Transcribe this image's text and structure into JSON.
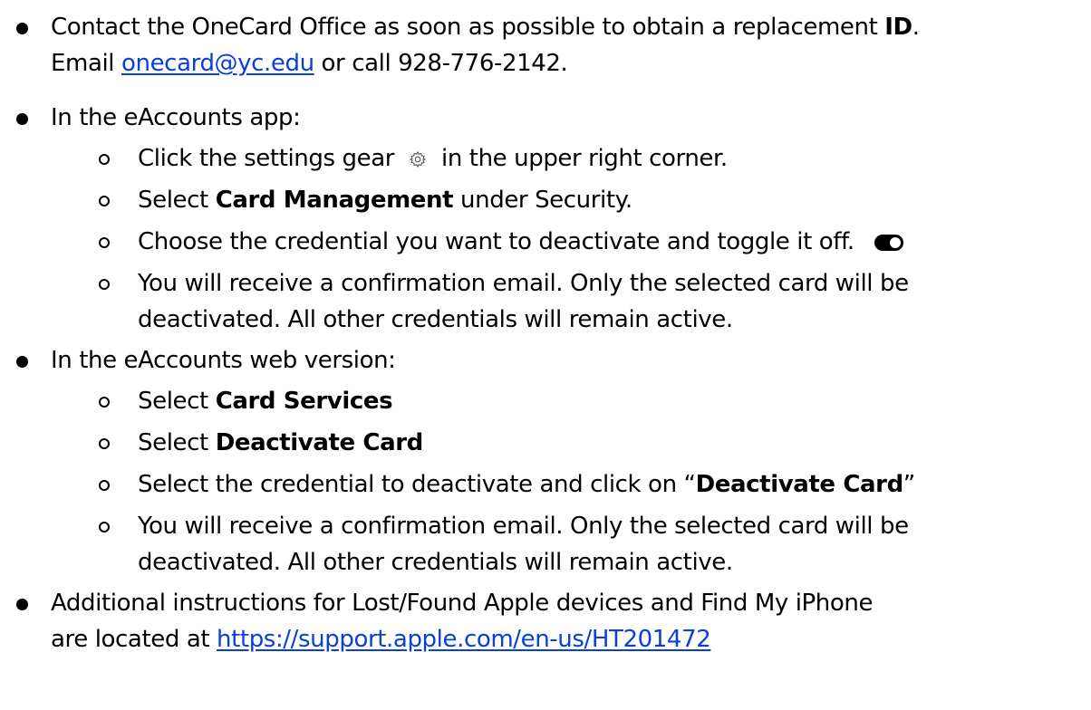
{
  "items": [
    {
      "line1_pre": "Contact the OneCard Office as soon as possible to obtain a replacement ",
      "line1_bold": "ID",
      "line1_post": ".",
      "line2_pre": "Email ",
      "email": "onecard@yc.edu",
      "line2_post": " or call 928-776-2142."
    },
    {
      "text": "In the eAccounts app:",
      "sub": [
        {
          "pre": "Click the settings gear",
          "icon": "gear-icon",
          "post": "in the upper right corner."
        },
        {
          "pre": "Select ",
          "bold": "Card Management",
          "post": " under Security."
        },
        {
          "text": "Choose the credential you want to deactivate and toggle it off.",
          "icon": "toggle-icon"
        },
        {
          "line1": "You will receive a confirmation email. Only the selected card will be",
          "line2": "deactivated. All other credentials will remain active."
        }
      ]
    },
    {
      "text": "In the eAccounts web version:",
      "sub": [
        {
          "pre": "Select ",
          "bold": "Card Services"
        },
        {
          "pre": "Select ",
          "bold": "Deactivate Card"
        },
        {
          "pre": "Select the credential to deactivate and click on “",
          "bold": "Deactivate Card",
          "post": "”"
        },
        {
          "line1": "You will receive a confirmation email. Only the selected card will be",
          "line2": "deactivated. All other credentials will remain active."
        }
      ]
    },
    {
      "line1": "Additional instructions for Lost/Found Apple devices and Find My iPhone",
      "line2_pre": "are located at ",
      "url": "https://support.apple.com/en-us/HT201472"
    }
  ]
}
